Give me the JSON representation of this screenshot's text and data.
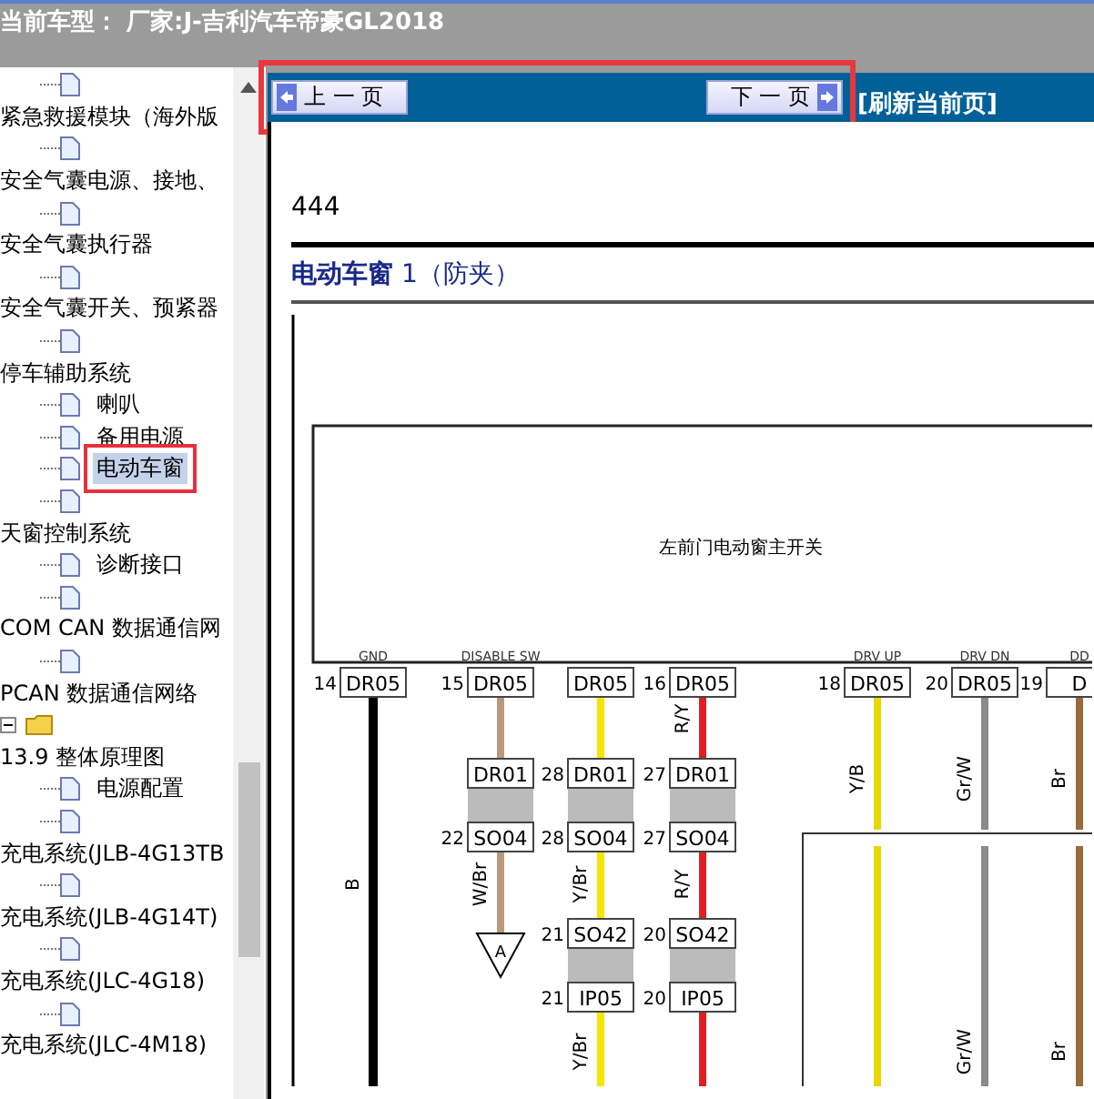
{
  "header": {
    "title": "当前车型： 厂家:J-吉利汽车帝豪GL2018"
  },
  "tree": [
    {
      "kind": "doc"
    },
    {
      "kind": "heading",
      "label": "紧急救援模块（海外版"
    },
    {
      "kind": "doc"
    },
    {
      "kind": "heading",
      "label": "安全气囊电源、接地、"
    },
    {
      "kind": "doc"
    },
    {
      "kind": "heading",
      "label": "安全气囊执行器"
    },
    {
      "kind": "doc"
    },
    {
      "kind": "heading",
      "label": "安全气囊开关、预紧器"
    },
    {
      "kind": "doc"
    },
    {
      "kind": "heading",
      "label": "停车辅助系统"
    },
    {
      "kind": "doc",
      "label": "喇叭",
      "selected": false
    },
    {
      "kind": "doc",
      "label": "备用电源",
      "selected": false
    },
    {
      "kind": "doc",
      "label": "电动车窗",
      "selected": true
    },
    {
      "kind": "doc"
    },
    {
      "kind": "heading",
      "label": "天窗控制系统"
    },
    {
      "kind": "doc",
      "label": "诊断接口",
      "selected": false
    },
    {
      "kind": "doc"
    },
    {
      "kind": "heading",
      "label": "COM CAN 数据通信网"
    },
    {
      "kind": "doc"
    },
    {
      "kind": "heading",
      "label": "PCAN 数据通信网络"
    },
    {
      "kind": "folder",
      "expanded": true
    },
    {
      "kind": "heading",
      "label": "13.9 整体原理图"
    },
    {
      "kind": "doc",
      "label": "电源配置",
      "selected": false
    },
    {
      "kind": "doc"
    },
    {
      "kind": "heading",
      "label": "充电系统(JLB-4G13TB"
    },
    {
      "kind": "doc"
    },
    {
      "kind": "heading",
      "label": "充电系统(JLB-4G14T)"
    },
    {
      "kind": "doc"
    },
    {
      "kind": "heading",
      "label": "充电系统(JLC-4G18)"
    },
    {
      "kind": "doc"
    },
    {
      "kind": "heading",
      "label": "充电系统(JLC-4M18)"
    }
  ],
  "nav": {
    "highlighted": true,
    "prev": "上 一 页",
    "next": "下 一 页",
    "refresh": "[刷新当前页]"
  },
  "document": {
    "page_number": "444",
    "title": "电动车窗",
    "title_suffix": " 1（防夹）",
    "diagram": {
      "component": "左前门电动窗主开关",
      "columns": [
        {
          "signal": "GND",
          "number": "14",
          "code": "DR05",
          "color": "#000000",
          "middle_label": "B"
        },
        {
          "signal": "DISABLE SW",
          "number": "15",
          "code": "DR05",
          "color": "#b89a7a",
          "pairs": [
            {
              "top": {
                "code": "DR01"
              },
              "bottom": {
                "number": "22",
                "code": "SO04"
              }
            }
          ],
          "middle_label": "W/Br",
          "terminal": "A"
        },
        {
          "code": "DR05",
          "color": "#f5e600",
          "pairs": [
            {
              "top": {
                "number": "28",
                "code": "DR01"
              },
              "bottom": {
                "number": "28",
                "code": "SO04"
              }
            },
            {
              "top": {
                "number": "21",
                "code": "SO42"
              },
              "bottom": {
                "number": "21",
                "code": "IP05"
              }
            }
          ],
          "middle_label": "Y/Br",
          "lower_label": "Y/Br"
        },
        {
          "number": "16",
          "code": "DR05",
          "color": "#e02020",
          "pairs": [
            {
              "top": {
                "number": "27",
                "code": "DR01"
              },
              "bottom": {
                "number": "27",
                "code": "SO04"
              }
            },
            {
              "top": {
                "number": "20",
                "code": "SO42"
              },
              "bottom": {
                "number": "20",
                "code": "IP05"
              }
            }
          ],
          "upper_label": "R/Y",
          "middle_label": "R/Y"
        },
        {
          "signal": "DRV UP",
          "number": "18",
          "code": "DR05",
          "color": "#e8d800",
          "upper_label": "Y/B"
        },
        {
          "signal": "DRV DN",
          "number": "20",
          "code": "DR05",
          "color": "#8a8a8a",
          "upper_label": "Gr/W",
          "lower_label": "Gr/W"
        },
        {
          "signal": "DD",
          "number": "19",
          "code": "D",
          "color": "#9a6a3a",
          "upper_label": "Br",
          "lower_label": "Br"
        }
      ]
    }
  }
}
